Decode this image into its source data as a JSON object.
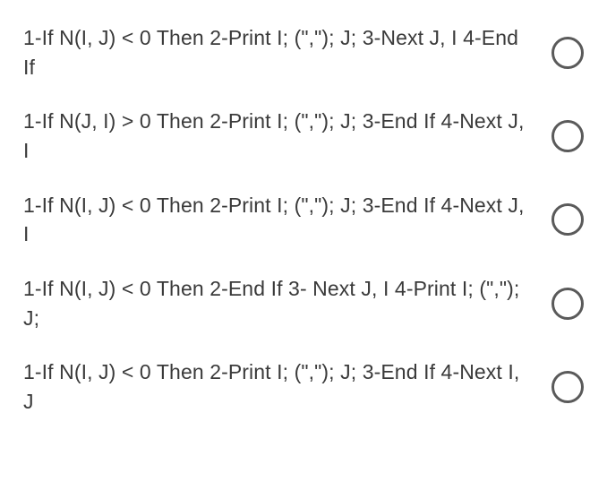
{
  "options": [
    {
      "text": "1-If N(I, J) < 0 Then 2-Print I; (\",\"); J; 3-Next J, I 4-End If"
    },
    {
      "text": "1-If N(J, I) > 0 Then 2-Print I; (\",\"); J; 3-End If 4-Next J, I"
    },
    {
      "text": "1-If N(I, J) < 0 Then 2-Print I; (\",\"); J; 3-End If 4-Next J, I"
    },
    {
      "text": "1-If N(I, J) < 0 Then 2-End If 3- Next J, I 4-Print I; (\",\"); J;"
    },
    {
      "text": "1-If N(I, J) < 0 Then 2-Print I; (\",\"); J; 3-End If 4-Next I, J"
    }
  ]
}
